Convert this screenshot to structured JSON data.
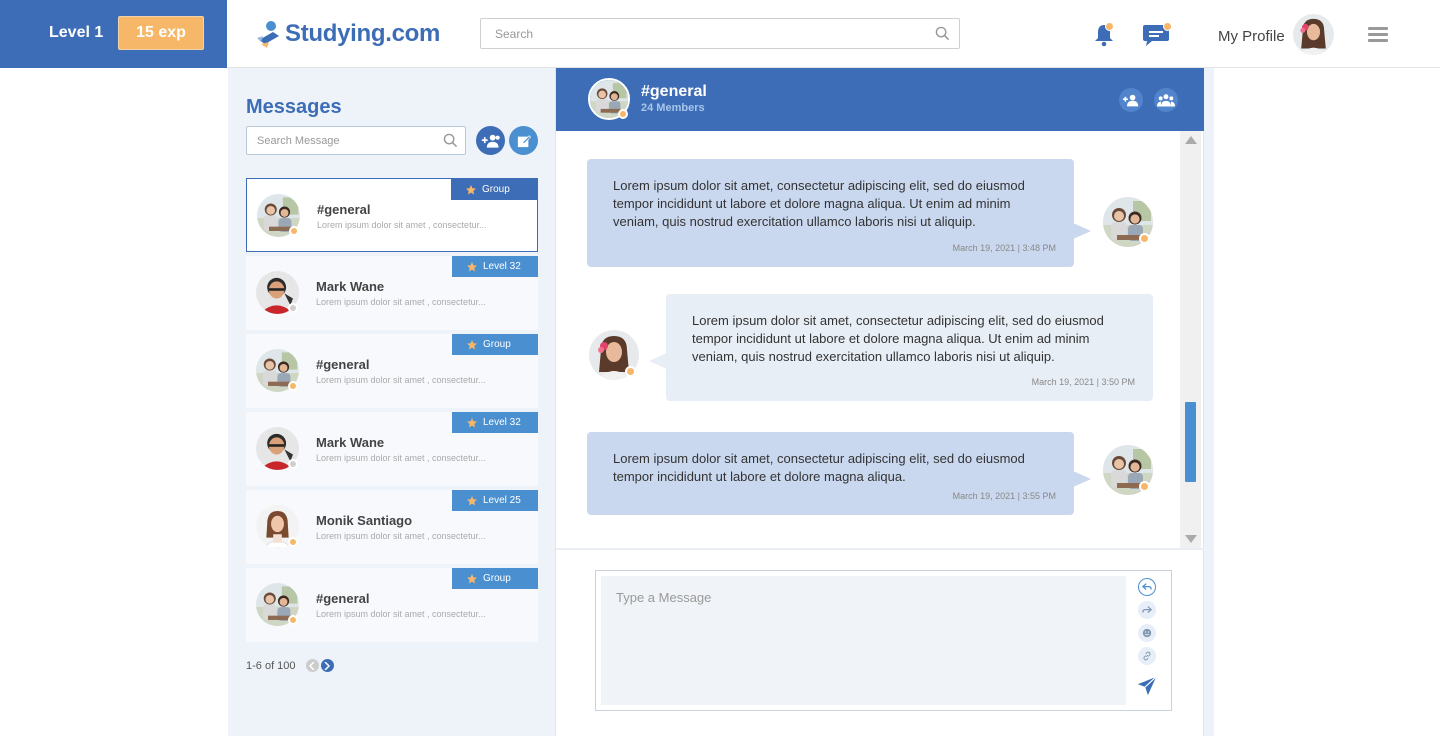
{
  "header": {
    "level_label": "Level 1",
    "exp_label": "15 exp",
    "logo_text": "Studying.com",
    "search_placeholder": "Search",
    "profile_label": "My Profile"
  },
  "icons": {
    "search": "search-icon",
    "bell": "bell-icon",
    "chat": "chat-icon",
    "menu": "hamburger-icon",
    "add_user": "add-user-icon",
    "group": "group-icon",
    "compose": "compose-icon",
    "star": "star-icon",
    "reply": "reply-icon",
    "forward": "forward-icon",
    "emoji": "emoji-icon",
    "link": "link-icon",
    "send": "send-icon"
  },
  "colors": {
    "primary": "#3d6db6",
    "accent_blue": "#4a8fd0",
    "exp_orange": "#f6b768",
    "panel_bg": "#eef3f9",
    "bubble_self": "#c9d8ef",
    "bubble_other": "#e8eef6"
  },
  "messages_panel": {
    "title": "Messages",
    "search_placeholder": "Search Message",
    "conversations": [
      {
        "name": "#general",
        "preview": "Lorem ipsum dolor sit amet , consectetur...",
        "tag": "Group",
        "avatar": "group",
        "status": "away",
        "active": true
      },
      {
        "name": "Mark Wane",
        "preview": "Lorem ipsum dolor sit amet , consectetur...",
        "tag": "Level 32",
        "avatar": "man",
        "status": "offline",
        "active": false
      },
      {
        "name": "#general",
        "preview": "Lorem ipsum dolor sit amet , consectetur...",
        "tag": "Group",
        "avatar": "group",
        "status": "away",
        "active": false
      },
      {
        "name": "Mark Wane",
        "preview": "Lorem ipsum dolor sit amet , consectetur...",
        "tag": "Level 32",
        "avatar": "man",
        "status": "offline",
        "active": false
      },
      {
        "name": "Monik Santiago",
        "preview": "Lorem ipsum dolor sit amet , consectetur...",
        "tag": "Level 25",
        "avatar": "woman2",
        "status": "away",
        "active": false
      },
      {
        "name": "#general",
        "preview": "Lorem ipsum dolor sit amet , consectetur...",
        "tag": "Group",
        "avatar": "group",
        "status": "away",
        "active": false
      }
    ],
    "pagination": "1-6 of 100"
  },
  "chat": {
    "title": "#general",
    "members": "24 Members",
    "messages": [
      {
        "side": "self",
        "text": "Lorem ipsum dolor sit amet, consectetur adipiscing elit, sed do eiusmod tempor incididunt ut labore et dolore magna aliqua. Ut enim ad minim veniam, quis nostrud exercitation ullamco laboris nisi ut aliquip.",
        "time": "March 19, 2021 | 3:48 PM"
      },
      {
        "side": "other",
        "text": "Lorem ipsum dolor sit amet, consectetur adipiscing elit, sed do eiusmod tempor incididunt ut labore et dolore magna aliqua. Ut enim ad minim veniam, quis nostrud exercitation ullamco laboris nisi ut aliquip.",
        "time": "March 19, 2021 | 3:50 PM"
      },
      {
        "side": "self",
        "text": "Lorem ipsum dolor sit amet, consectetur adipiscing elit, sed do eiusmod tempor incididunt ut labore et dolore magna aliqua.",
        "time": "March 19, 2021 | 3:55 PM"
      }
    ],
    "composer_placeholder": "Type a Message"
  }
}
